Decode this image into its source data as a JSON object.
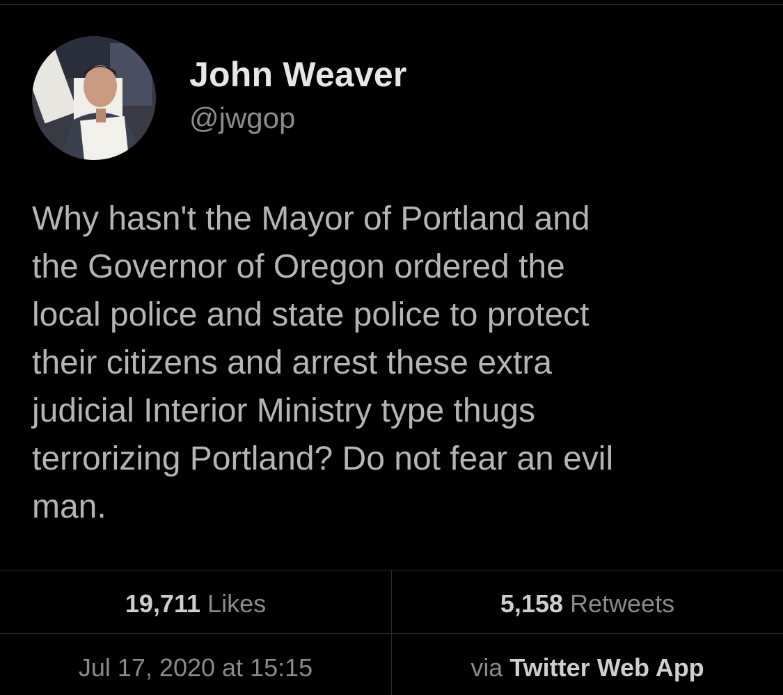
{
  "author": {
    "display_name": "John Weaver",
    "handle": "@jwgop"
  },
  "tweet": {
    "text": "Why hasn't the Mayor of Portland and\nthe Governor of Oregon ordered the\nlocal police and state police to protect\ntheir citizens and arrest these extra\njudicial Interior Ministry type thugs\nterrorizing Portland? Do not fear an evil\nman."
  },
  "stats": {
    "likes_count": "19,711",
    "likes_label": "Likes",
    "retweets_count": "5,158",
    "retweets_label": "Retweets"
  },
  "meta": {
    "timestamp": "Jul 17, 2020 at 15:15",
    "via_prefix": "via",
    "source_app": "Twitter Web App"
  },
  "colors": {
    "background": "#000000",
    "name": "#e6e6e6",
    "handle": "#8c8c8c",
    "body_text": "#b5b5b5",
    "divider": "#2c2c2c"
  }
}
